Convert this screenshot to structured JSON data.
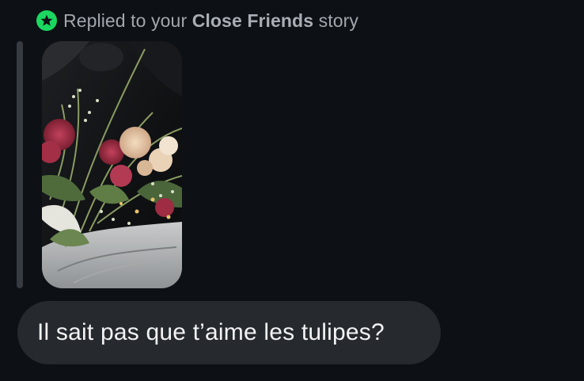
{
  "reply_header": {
    "icon": "close-friends-star-icon",
    "prefix": "Replied to your ",
    "highlight": "Close Friends",
    "suffix": " story"
  },
  "message": {
    "text": "Il sait pas que t’aime les tulipes?"
  },
  "colors": {
    "background": "#0d1014",
    "close_friends_green": "#1bd760",
    "bubble": "#26292e",
    "quote_bar": "#363b42",
    "header_text": "#a2a7ae",
    "message_text": "#f2f3f5"
  }
}
